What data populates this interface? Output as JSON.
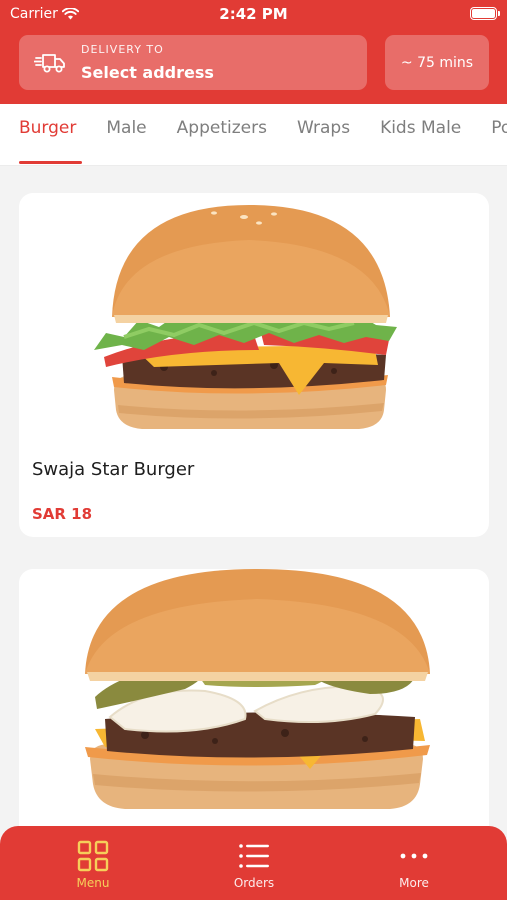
{
  "status_bar": {
    "carrier": "Carrier",
    "time": "2:42 PM"
  },
  "header": {
    "delivery_label": "DELIVERY TO",
    "address_value": "Select address",
    "eta": "~ 75 mins"
  },
  "categories": {
    "items": [
      "Burger",
      "Male",
      "Appetizers",
      "Wraps",
      "Kids Male",
      "Po"
    ],
    "active": "Burger"
  },
  "products": [
    {
      "name": "Swaja Star Burger",
      "price": "SAR 18"
    },
    {
      "name": "",
      "price": ""
    }
  ],
  "bottom_nav": {
    "items": [
      {
        "label": "Menu",
        "icon": "grid-icon",
        "active": true
      },
      {
        "label": "Orders",
        "icon": "list-icon",
        "active": false
      },
      {
        "label": "More",
        "icon": "more-dots-icon",
        "active": false
      }
    ]
  },
  "colors": {
    "brand": "#e13b35",
    "active_nav": "#f6cf5a",
    "tab_inactive": "#7e7e7e"
  }
}
